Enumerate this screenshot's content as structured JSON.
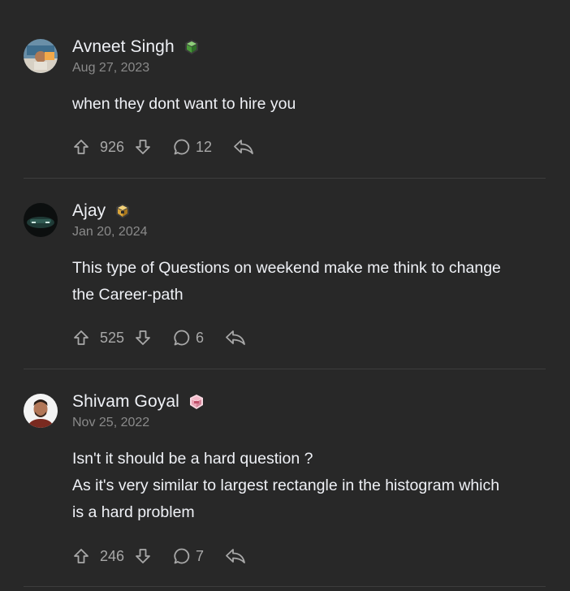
{
  "comments": [
    {
      "author": "Avneet Singh",
      "date": "Aug 27, 2023",
      "body": [
        "when they dont want to hire you"
      ],
      "upvotes": "926",
      "replies": "12",
      "badge_icon": "green-cube-badge-icon"
    },
    {
      "author": "Ajay",
      "date": "Jan 20, 2024",
      "body": [
        "This type of Questions on weekend make me think to change",
        "the Career-path"
      ],
      "upvotes": "525",
      "replies": "6",
      "badge_icon": "gold-cube-badge-icon"
    },
    {
      "author": "Shivam Goyal",
      "date": "Nov 25, 2022",
      "body": [
        "Isn't it should be a hard question ?",
        "As it's very similar to largest rectangle in the histogram which",
        "is a hard problem"
      ],
      "upvotes": "246",
      "replies": "7",
      "badge_icon": "pink-cube-badge-icon"
    }
  ],
  "colors": {
    "background": "#282828",
    "text": "#eff1f6",
    "muted": "#8a8a8a",
    "icon": "#a8a8a8",
    "divider": "#3d3d3d"
  }
}
